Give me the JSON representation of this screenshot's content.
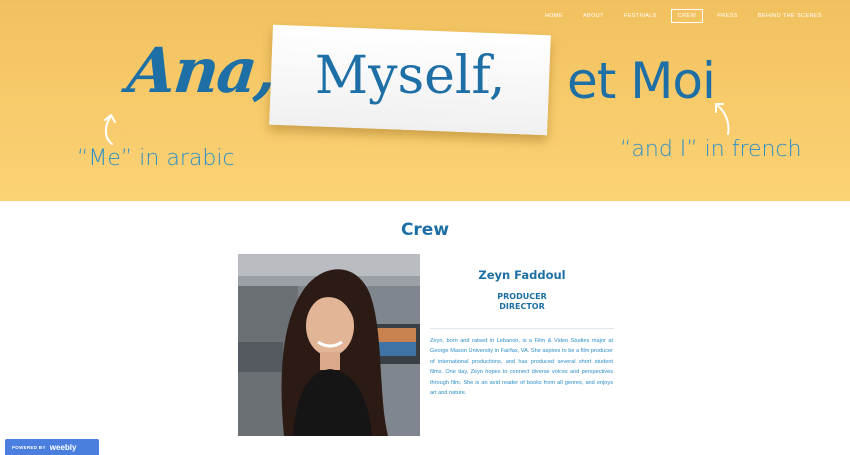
{
  "nav": {
    "items": [
      {
        "label": "HOME"
      },
      {
        "label": "ABOUT"
      },
      {
        "label": "FESTIVALS"
      },
      {
        "label": "CREW",
        "active": true
      },
      {
        "label": "PRESS"
      },
      {
        "label": "BEHIND THE SCENES"
      }
    ]
  },
  "banner": {
    "title_part1": "Ana,",
    "title_part2": "Myself,",
    "title_part3": "et Moi",
    "caption_left": "“Me” in arabic",
    "caption_right": "“and I” in french",
    "background_color": "#f6c868",
    "title_color": "#1e6fa5",
    "caption_color": "#2c8ec7"
  },
  "main": {
    "heading": "Crew",
    "member": {
      "name": "Zeyn Faddoul",
      "role_1": "PRODUCER",
      "role_2": "DIRECTOR",
      "bio": "Zeyn, born and raised in Lebanon, is a Film & Video Studies major at George Mason University in Fairfax, VA. She aspires to be a film producer of international productions, and has produced several short student films. One day, Zeyn hopes to connect diverse voices and perspectives through film. She is an avid reader of books from all genres, and enjoys art and nature."
    }
  },
  "footer_badge": {
    "prefix": "POWERED BY",
    "brand": "weebly",
    "color": "#4a7fe0"
  }
}
